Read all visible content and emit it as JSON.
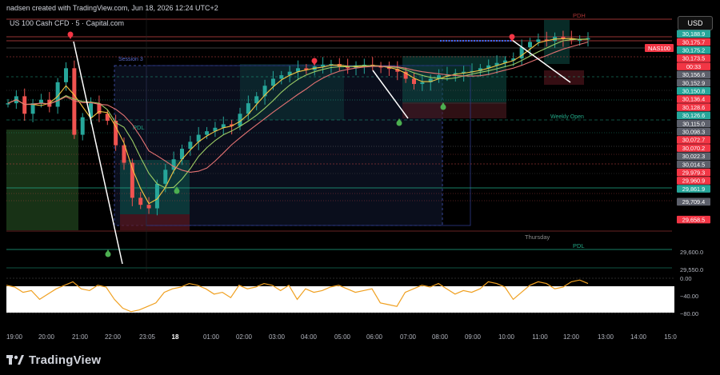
{
  "header": {
    "author_line": "nadsen created with TradingView.com, Jun 18, 2026 12:24 UTC+2",
    "symbol": "US 100 Cash CFD · 5 · Capital.com"
  },
  "currency_button": "USD",
  "footer": {
    "brand": "TradingView"
  },
  "chart_data": {
    "type": "candlestick",
    "instrument": "US 100 Cash CFD",
    "timeframe": "5",
    "exchange": "Capital.com",
    "ylim": [
      29520,
      30230
    ],
    "x_ticks": [
      "19:00",
      "20:00",
      "21:00",
      "22:00",
      "23:05",
      "18",
      "01:00",
      "02:00",
      "03:00",
      "04:00",
      "05:00",
      "06:00",
      "07:00",
      "08:00",
      "09:00",
      "10:00",
      "11:00",
      "12:00",
      "13:00",
      "14:00",
      "15:0"
    ],
    "y_ticks": [
      "29,600.0",
      "29,550.0"
    ],
    "price_labels": [
      {
        "text": "30,188.9",
        "value": 30188.9,
        "color": "#26a69a"
      },
      {
        "text": "30,175.7",
        "value": 30175.7,
        "color": "#f23645"
      },
      {
        "text": "00:33",
        "value": 30164.0,
        "color": "#f23645"
      },
      {
        "text": "30,175.2",
        "value": 30175.2,
        "color": "#26a69a"
      },
      {
        "text": "30,173.5",
        "value": 30173.5,
        "color": "#f23645"
      },
      {
        "text": "30,156.6",
        "value": 30156.6,
        "color": "#5d606b"
      },
      {
        "text": "30,152.9",
        "value": 30152.9,
        "color": "#5d606b"
      },
      {
        "text": "30,150.8",
        "value": 30150.8,
        "color": "#26a69a"
      },
      {
        "text": "30,136.4",
        "value": 30136.4,
        "color": "#f23645"
      },
      {
        "text": "30,128.6",
        "value": 30128.6,
        "color": "#f23645"
      },
      {
        "text": "30,126.6",
        "value": 30126.6,
        "color": "#26a69a"
      },
      {
        "text": "30,115.0",
        "value": 30115.0,
        "color": "#5d606b"
      },
      {
        "text": "30,098.3",
        "value": 30098.3,
        "color": "#5d606b"
      },
      {
        "text": "30,072.7",
        "value": 30072.7,
        "color": "#f23645"
      },
      {
        "text": "30,070.2",
        "value": 30070.2,
        "color": "#f23645"
      },
      {
        "text": "30,022.3",
        "value": 30022.3,
        "color": "#5d606b"
      },
      {
        "text": "30,014.5",
        "value": 30014.5,
        "color": "#5d606b"
      },
      {
        "text": "29,979.3",
        "value": 29979.3,
        "color": "#f23645"
      },
      {
        "text": "29,960.9",
        "value": 29960.9,
        "color": "#f23645"
      },
      {
        "text": "29,861.9",
        "value": 29861.9,
        "color": "#26a69a"
      },
      {
        "text": "29,709.4",
        "value": 29709.4,
        "color": "#5d606b"
      },
      {
        "text": "29,658.5",
        "value": 29658.5,
        "color": "#f23645"
      }
    ],
    "symbol_tag": "NAS100",
    "annotations": [
      "PDH",
      "Session 3",
      "PDL",
      "Weekly Open",
      "Thursday",
      "PDL"
    ],
    "close_series": [
      29990,
      30010,
      29960,
      29990,
      30000,
      29980,
      30050,
      30090,
      29900,
      29950,
      29990,
      29960,
      29940,
      29870,
      29820,
      29720,
      29700,
      29690,
      29760,
      29800,
      29830,
      29860,
      29880,
      29900,
      29910,
      29920,
      29930,
      29925,
      29960,
      29990,
      30010,
      30040,
      30060,
      30070,
      30080,
      30090,
      30085,
      30095,
      30100,
      30102,
      30095,
      30090,
      30098,
      30100,
      30096,
      30092,
      30088,
      30080,
      30060,
      30045,
      30050,
      30060,
      30070,
      30072,
      30076,
      30080,
      30082,
      30090,
      30098,
      30105,
      30112,
      30118,
      30150,
      30165,
      30172,
      30168,
      30180,
      30175,
      30170,
      30172,
      30176
    ],
    "oscillator": {
      "ylim": [
        -100,
        0
      ],
      "y_ticks": [
        "0.00",
        "−40.00",
        "−80.00"
      ],
      "values": [
        -20,
        -25,
        -40,
        -35,
        -60,
        -45,
        -30,
        -20,
        -10,
        -30,
        -35,
        -20,
        -25,
        -60,
        -85,
        -95,
        -90,
        -80,
        -70,
        -40,
        -30,
        -25,
        -15,
        -20,
        -30,
        -45,
        -40,
        -55,
        -20,
        -30,
        -25,
        -15,
        -20,
        -35,
        -20,
        -60,
        -30,
        -40,
        -35,
        -25,
        -20,
        -30,
        -40,
        -35,
        -30,
        -70,
        -75,
        -80,
        -40,
        -30,
        -20,
        -25,
        -15,
        -30,
        -45,
        -35,
        -40,
        -30,
        -10,
        -15,
        -25,
        -60,
        -40,
        -20,
        -10,
        -15,
        -30,
        -25,
        -10,
        -5,
        -15
      ]
    }
  }
}
